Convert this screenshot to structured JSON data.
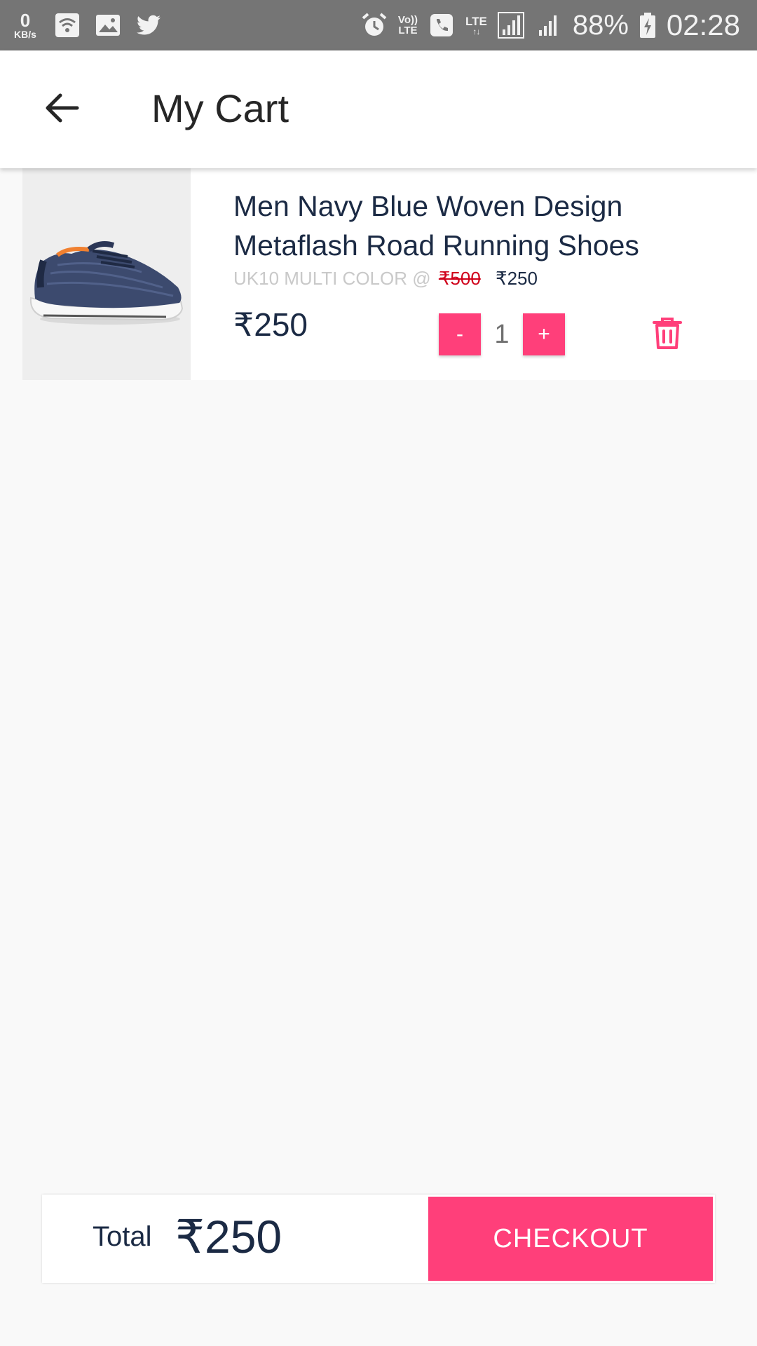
{
  "status_bar": {
    "net_speed_value": "0",
    "net_speed_unit": "KB/s",
    "volte_top": "Vo))",
    "volte_bottom": "LTE",
    "lte_label": "LTE",
    "lte_arrows": "↑↓",
    "battery_percent": "88%",
    "time": "02:28",
    "icons": [
      "wifi-icon",
      "image-icon",
      "twitter-icon",
      "alarm-icon",
      "phone-icon",
      "signal-icon",
      "battery-charging-icon"
    ]
  },
  "app_bar": {
    "back_icon": "arrow-left-icon",
    "title": "My Cart"
  },
  "cart": {
    "items": [
      {
        "name": "Men Navy Blue Woven Design Metaflash Road Running Shoes",
        "variant_prefix": "UK10 MULTI COLOR @",
        "original_price": "₹500",
        "sale_price": "₹250",
        "line_price": "₹250",
        "quantity": "1",
        "decrement_label": "-",
        "increment_label": "+",
        "delete_icon": "trash-icon",
        "image": "sneaker-image"
      }
    ]
  },
  "summary": {
    "total_label": "Total",
    "total_value": "₹250",
    "checkout_label": "CHECKOUT"
  },
  "colors": {
    "status_bar": "#757575",
    "accent": "#ff3f7a",
    "text_primary": "#1b2a44",
    "strike_price": "#d0021b",
    "background": "#f9f9f9"
  }
}
